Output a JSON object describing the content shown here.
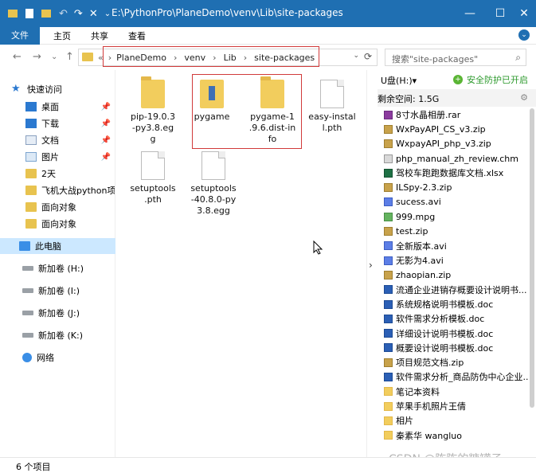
{
  "titlebar": {
    "path": "E:\\PythonPro\\PlaneDemo\\venv\\Lib\\site-packages",
    "minimize": "—",
    "maximize": "☐",
    "close": "✕"
  },
  "ribbon": {
    "tabs": [
      "文件",
      "主页",
      "共享",
      "查看"
    ]
  },
  "navigation": {
    "back": "←",
    "forward": "→",
    "recent": "⌄",
    "up": "↑",
    "address_crumbs": [
      "«",
      "PlaneDemo",
      "venv",
      "Lib",
      "site-packages"
    ],
    "refresh": "⟳",
    "search_placeholder": "搜索\"site-packages\""
  },
  "sidebar": {
    "items": [
      {
        "label": "快速访问",
        "icon": "star-icon"
      },
      {
        "label": "桌面",
        "icon": "desktop-icon",
        "pinned": true
      },
      {
        "label": "下载",
        "icon": "download-icon",
        "pinned": true
      },
      {
        "label": "文档",
        "icon": "document-icon",
        "pinned": true
      },
      {
        "label": "图片",
        "icon": "picture-icon",
        "pinned": true
      },
      {
        "label": "2天",
        "icon": "folder-icon"
      },
      {
        "label": "飞机大战python项目",
        "icon": "folder-icon"
      },
      {
        "label": "面向对象",
        "icon": "folder-icon"
      },
      {
        "label": "面向对象",
        "icon": "folder-icon"
      },
      {
        "label": "此电脑",
        "icon": "computer-icon"
      },
      {
        "label": "新加卷 (H:)",
        "icon": "drive-icon"
      },
      {
        "label": "新加卷 (I:)",
        "icon": "drive-icon"
      },
      {
        "label": "新加卷 (J:)",
        "icon": "drive-icon"
      },
      {
        "label": "新加卷 (K:)",
        "icon": "drive-icon"
      },
      {
        "label": "网络",
        "icon": "network-icon"
      }
    ]
  },
  "files": [
    {
      "name": "pip-19.0.3\n-py3.8.eg\ng",
      "type": "folder"
    },
    {
      "name": "pygame",
      "type": "package-folder"
    },
    {
      "name": "pygame-1\n.9.6.dist-in\nfo",
      "type": "folder"
    },
    {
      "name": "easy-instal\nl.pth",
      "type": "file"
    },
    {
      "name": "setuptools\n.pth",
      "type": "file"
    },
    {
      "name": "setuptools\n-40.8.0-py\n3.8.egg",
      "type": "file"
    }
  ],
  "status": {
    "count": "6 个项目"
  },
  "usb_panel": {
    "drive": "U盘(H:)▾",
    "protect": "安全防护已开启",
    "space": "剩余空间: 1.5G",
    "files": [
      {
        "name": "8寸水晶相册.rar",
        "kind": "rar"
      },
      {
        "name": "WxPayAPI_CS_v3.zip",
        "kind": "zip"
      },
      {
        "name": "WxpayAPI_php_v3.zip",
        "kind": "zip"
      },
      {
        "name": "php_manual_zh_review.chm",
        "kind": "chm"
      },
      {
        "name": "驾校车跑跑数据库文档.xlsx",
        "kind": "xlsx"
      },
      {
        "name": "ILSpy-2.3.zip",
        "kind": "zip"
      },
      {
        "name": "sucess.avi",
        "kind": "avi"
      },
      {
        "name": "999.mpg",
        "kind": "mpg"
      },
      {
        "name": "test.zip",
        "kind": "zip"
      },
      {
        "name": "全新版本.avi",
        "kind": "avi"
      },
      {
        "name": "无影为4.avi",
        "kind": "avi"
      },
      {
        "name": "zhaopian.zip",
        "kind": "zip"
      },
      {
        "name": "流通企业进销存概要设计说明书...",
        "kind": "doc"
      },
      {
        "name": "系统规格说明书模板.doc",
        "kind": "doc"
      },
      {
        "name": "软件需求分析模板.doc",
        "kind": "doc"
      },
      {
        "name": "详细设计说明书模板.doc",
        "kind": "doc"
      },
      {
        "name": "概要设计说明书模板.doc",
        "kind": "doc"
      },
      {
        "name": "项目规范文档.zip",
        "kind": "zip"
      },
      {
        "name": "软件需求分析_商品防伪中心企业...",
        "kind": "doc"
      },
      {
        "name": "笔记本资料",
        "kind": "folder"
      },
      {
        "name": "苹果手机照片王倩",
        "kind": "folder"
      },
      {
        "name": "相片",
        "kind": "folder"
      },
      {
        "name": "秦素华 wangluo",
        "kind": "folder"
      }
    ]
  },
  "watermark": "CSDN @陈陈的糖罐子"
}
